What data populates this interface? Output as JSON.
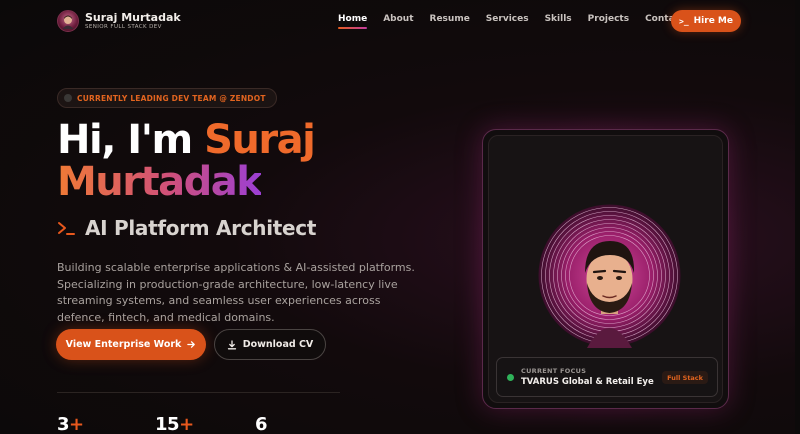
{
  "brand": {
    "name": "Suraj Murtadak",
    "subtitle": "SENIOR FULL STACK DEV"
  },
  "nav": {
    "items": [
      "Home",
      "About",
      "Resume",
      "Services",
      "Skills",
      "Projects",
      "Contact"
    ],
    "active": "Home",
    "hire_label": "Hire Me"
  },
  "badge": {
    "text": "CURRENTLY LEADING DEV TEAM @ ZENDOT"
  },
  "hero": {
    "greeting": "Hi, I'm",
    "first_name": "Suraj",
    "last_name": "Murtadak",
    "role": "AI Platform Architect",
    "description": "Building scalable enterprise applications & AI-assisted platforms. Specializing in production-grade architecture, low-latency live streaming systems, and seamless user experiences across defence, fintech, and medical domains."
  },
  "actions": {
    "primary_label": "View Enterprise Work",
    "secondary_label": "Download CV"
  },
  "stats": [
    {
      "value": "3",
      "suffix": "+"
    },
    {
      "value": "15",
      "suffix": "+"
    },
    {
      "value": "6",
      "suffix": ""
    }
  ],
  "focus_card": {
    "label": "CURRENT FOCUS",
    "value": "TVARUS Global & Retail Eye",
    "tag": "Full Stack"
  },
  "colors": {
    "accent": "#d9521a",
    "accent_purple": "#9b3fd4",
    "status_green": "#2fb35a"
  }
}
